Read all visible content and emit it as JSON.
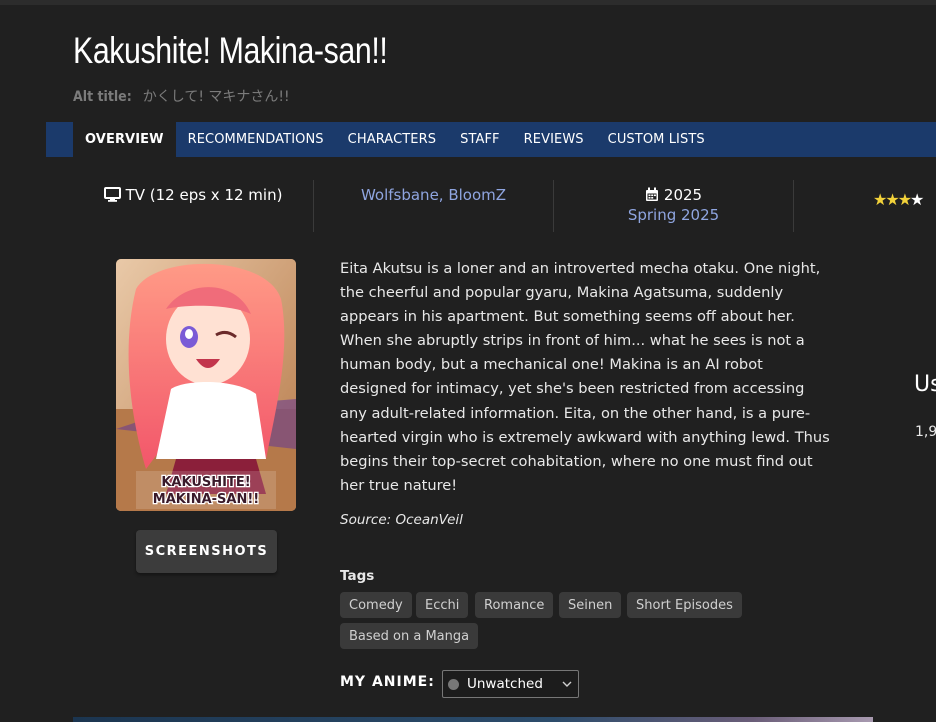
{
  "title": "Kakushite! Makina-san!!",
  "alt_title": {
    "label": "Alt title:",
    "value": "かくして! マキナさん!!"
  },
  "nav": {
    "tabs": [
      {
        "label": "OVERVIEW",
        "active": true
      },
      {
        "label": "RECOMMENDATIONS"
      },
      {
        "label": "CHARACTERS"
      },
      {
        "label": "STAFF"
      },
      {
        "label": "REVIEWS"
      },
      {
        "label": "CUSTOM LISTS"
      }
    ]
  },
  "info": {
    "type": "TV (12 eps x 12 min)",
    "studios": [
      "Wolfsbane",
      "BloomZ"
    ],
    "studio_separator": ", ",
    "year": "2025",
    "season": "Spring 2025",
    "rating_stars": 3
  },
  "poster": {
    "caption_line1": "KAKUSHITE!",
    "caption_line2": "MAKINA-SAN!!"
  },
  "screenshots_label": "SCREENSHOTS",
  "synopsis": "Eita Akutsu is a loner and an introverted mecha otaku. One night, the cheerful and popular gyaru, Makina Agatsuma, suddenly appears in his apartment. But something seems off about her. When she abruptly strips in front of him... what he sees is not a human body, but a mechanical one! Makina is an AI robot designed for intimacy, yet she's been restricted from accessing any adult-related information. Eita, on the other hand, is a pure-hearted virgin who is extremely awkward with anything lewd. Thus begins their top-secret cohabitation, where no one must find out her true nature!",
  "source": "Source: OceanVeil",
  "tags_label": "Tags",
  "tags": [
    "Comedy",
    "Ecchi",
    "Romance",
    "Seinen",
    "Short Episodes",
    "Based on a Manga"
  ],
  "my_anime": {
    "label": "MY ANIME:",
    "status": "Unwatched"
  },
  "side": {
    "heading": "Us",
    "number": "1,9"
  },
  "colors": {
    "nav_bg": "#1b3a6b",
    "link": "#8fa5e0",
    "star": "#f2d23a",
    "page_bg": "#202020"
  },
  "icons": {
    "type": "monitor-icon",
    "year": "calendar-icon",
    "dropdown": "chevron-down-icon"
  }
}
